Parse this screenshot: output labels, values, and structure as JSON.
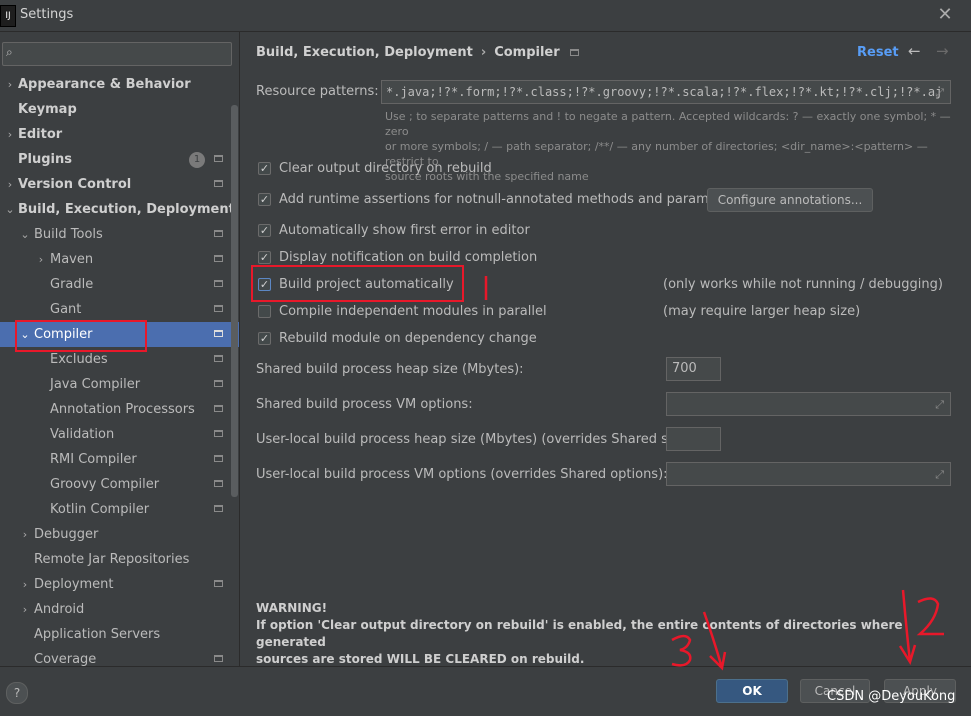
{
  "window": {
    "title": "Settings",
    "app_icon": "IJ"
  },
  "sidebar": {
    "search_placeholder": "",
    "badge": "1",
    "items": [
      {
        "label": "Appearance & Behavior",
        "level": 0,
        "arrow": "›",
        "bold": true
      },
      {
        "label": "Keymap",
        "level": 0,
        "arrow": "",
        "bold": true
      },
      {
        "label": "Editor",
        "level": 0,
        "arrow": "›",
        "bold": true
      },
      {
        "label": "Plugins",
        "level": 0,
        "arrow": "",
        "bold": true
      },
      {
        "label": "Version Control",
        "level": 0,
        "arrow": "›",
        "bold": true
      },
      {
        "label": "Build, Execution, Deployment",
        "level": 0,
        "arrow": "⌄",
        "bold": true
      },
      {
        "label": "Build Tools",
        "level": 1,
        "arrow": "⌄"
      },
      {
        "label": "Maven",
        "level": 2,
        "arrow": "›"
      },
      {
        "label": "Gradle",
        "level": 2,
        "arrow": ""
      },
      {
        "label": "Gant",
        "level": 2,
        "arrow": ""
      },
      {
        "label": "Compiler",
        "level": 1,
        "arrow": "⌄",
        "selected": true
      },
      {
        "label": "Excludes",
        "level": 2,
        "arrow": ""
      },
      {
        "label": "Java Compiler",
        "level": 2,
        "arrow": ""
      },
      {
        "label": "Annotation Processors",
        "level": 2,
        "arrow": ""
      },
      {
        "label": "Validation",
        "level": 2,
        "arrow": ""
      },
      {
        "label": "RMI Compiler",
        "level": 2,
        "arrow": ""
      },
      {
        "label": "Groovy Compiler",
        "level": 2,
        "arrow": ""
      },
      {
        "label": "Kotlin Compiler",
        "level": 2,
        "arrow": ""
      },
      {
        "label": "Debugger",
        "level": 1,
        "arrow": "›"
      },
      {
        "label": "Remote Jar Repositories",
        "level": 1,
        "arrow": ""
      },
      {
        "label": "Deployment",
        "level": 1,
        "arrow": "›"
      },
      {
        "label": "Android",
        "level": 1,
        "arrow": "›"
      },
      {
        "label": "Application Servers",
        "level": 1,
        "arrow": ""
      },
      {
        "label": "Coverage",
        "level": 1,
        "arrow": ""
      }
    ]
  },
  "header": {
    "crumb1": "Build, Execution, Deployment",
    "sep": "›",
    "crumb2": "Compiler",
    "reset": "Reset",
    "back": "←",
    "forward": "→"
  },
  "resource": {
    "label": "Resource patterns:",
    "value": "*.java;!?*.form;!?*.class;!?*.groovy;!?*.scala;!?*.flex;!?*.kt;!?*.clj;!?*.aj",
    "hint_line1": "Use ; to separate patterns and ! to negate a pattern. Accepted wildcards: ? — exactly one symbol; * — zero",
    "hint_line2": "or more symbols; / — path separator; /**/ — any number of directories; <dir_name>:<pattern> — restrict to",
    "hint_line3": "source roots with the specified name"
  },
  "options": {
    "clear_output": {
      "label": "Clear output directory on rebuild",
      "checked": true
    },
    "runtime_assertions": {
      "label": "Add runtime assertions for notnull-annotated methods and parameters",
      "checked": true
    },
    "configure_annotations": "Configure annotations...",
    "show_first_error": {
      "label": "Automatically show first error in editor",
      "checked": true
    },
    "display_notification": {
      "label": "Display notification on build completion",
      "checked": true
    },
    "build_automatically": {
      "label": "Build project automatically",
      "checked": true,
      "note": "(only works while not running / debugging)"
    },
    "compile_parallel": {
      "label": "Compile independent modules in parallel",
      "checked": false,
      "note": "(may require larger heap size)"
    },
    "rebuild_on_dependency": {
      "label": "Rebuild module on dependency change",
      "checked": true
    }
  },
  "fields": {
    "shared_heap": {
      "label": "Shared build process heap size (Mbytes):",
      "value": "700"
    },
    "shared_vm": {
      "label": "Shared build process VM options:",
      "value": ""
    },
    "local_heap": {
      "label": "User-local build process heap size (Mbytes) (overrides Shared size):",
      "value": ""
    },
    "local_vm": {
      "label": "User-local build process VM options (overrides Shared options):",
      "value": ""
    }
  },
  "warning": {
    "title": "WARNING!",
    "line1": "If option 'Clear output directory on rebuild' is enabled, the entire contents of directories where generated",
    "line2": "sources are stored WILL BE CLEARED on rebuild."
  },
  "footer": {
    "help": "?",
    "ok": "OK",
    "cancel": "Cancel",
    "apply": "Apply",
    "watermark": "CSDN @DeyouKong"
  },
  "colors": {
    "background": "#3c3f41",
    "selection": "#4b6eaf",
    "link": "#589df6",
    "annotation": "#e8182a"
  }
}
